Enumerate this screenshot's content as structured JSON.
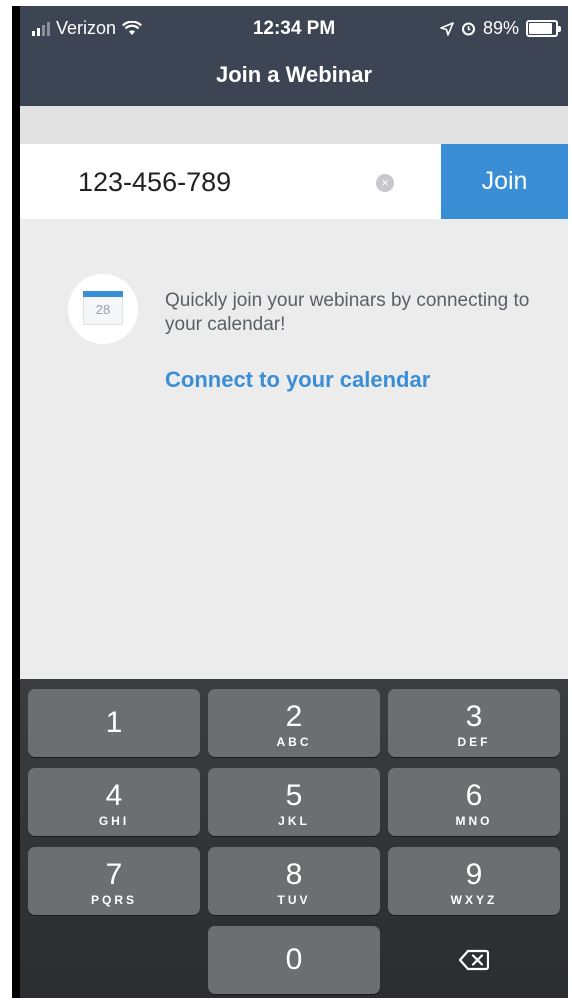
{
  "status_bar": {
    "carrier": "Verizon",
    "time": "12:34 PM",
    "battery": "89%",
    "battery_level": 0.89
  },
  "header": {
    "title": "Join a Webinar"
  },
  "join_form": {
    "webinar_id_value": "123-456-789",
    "clear_symbol": "×",
    "join_label": "Join"
  },
  "calendar_promo": {
    "calendar_day": "28",
    "message": "Quickly join your webinars by connecting to your calendar!",
    "link_label": "Connect to your calendar"
  },
  "keypad": {
    "keys": [
      {
        "digit": "1",
        "letters": ""
      },
      {
        "digit": "2",
        "letters": "ABC"
      },
      {
        "digit": "3",
        "letters": "DEF"
      },
      {
        "digit": "4",
        "letters": "GHI"
      },
      {
        "digit": "5",
        "letters": "JKL"
      },
      {
        "digit": "6",
        "letters": "MNO"
      },
      {
        "digit": "7",
        "letters": "PQRS"
      },
      {
        "digit": "8",
        "letters": "TUV"
      },
      {
        "digit": "9",
        "letters": "WXYZ"
      },
      {
        "digit": "0",
        "letters": ""
      }
    ]
  },
  "colors": {
    "header_bg": "#3d4453",
    "accent": "#3a8ed6",
    "page_bg": "#ececec",
    "keypad_bg": "#2c2d30",
    "key_bg": "#6d6e72"
  },
  "icons": {
    "signal": "cellular-signal-icon",
    "wifi": "wifi-icon",
    "location": "location-arrow-icon",
    "alarm": "alarm-clock-icon",
    "battery": "battery-icon",
    "clear": "clear-circle-icon",
    "calendar": "calendar-icon",
    "backspace": "backspace-icon"
  }
}
